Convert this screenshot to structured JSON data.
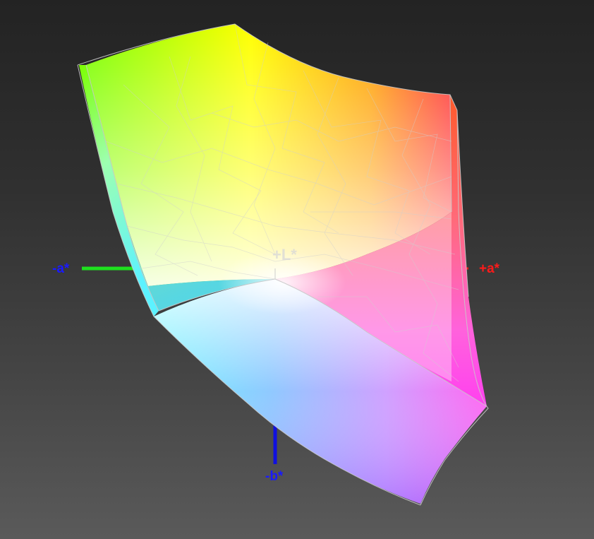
{
  "axes": {
    "neg_a": {
      "label": "-a*",
      "color": "#1a1aff",
      "line_color": "#1ee01e"
    },
    "pos_a": {
      "label": "+a*",
      "color": "#ff1a1a",
      "line_color": "#ff1a1a"
    },
    "neg_b": {
      "label": "-b*",
      "color": "#1a1aff",
      "line_color": "#1010e0"
    },
    "pos_l": {
      "label": "+L*",
      "color": "#d8d8d8"
    }
  },
  "gamut": {
    "corner_colors": {
      "green": "#7cff00",
      "yellow": "#ffff00",
      "orange": "#ff8a00",
      "red": "#ff2a2a",
      "magenta": "#ff4ff0",
      "blue_violet": "#9a6cff",
      "cyan": "#5cf2ff",
      "white": "#f4f4f4"
    },
    "wireframe_color": "#c8c8c8"
  }
}
